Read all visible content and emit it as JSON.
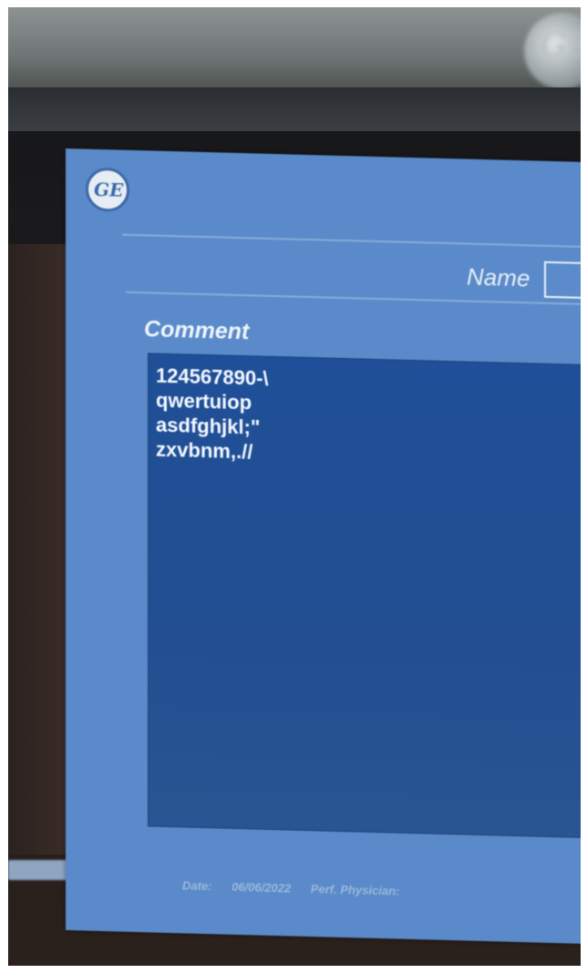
{
  "hardware": {
    "brand_logo": "ge-monogram-icon"
  },
  "dialog": {
    "logo": "ge-monogram-icon",
    "name_label": "Name",
    "name_value": "",
    "comment_label": "Comment",
    "comment_lines": [
      "124567890-\\",
      "qwertuiop",
      "asdfghjkl;\"",
      "zxvbnm,.//"
    ],
    "footer": {
      "date_label": "Date:",
      "date_value": "06/06/2022",
      "physician_label": "Perf. Physician:"
    }
  },
  "colors": {
    "dialog_bg": "#5a8ac9",
    "comment_bg": "#1f4f98",
    "text": "#f4f8ff"
  }
}
